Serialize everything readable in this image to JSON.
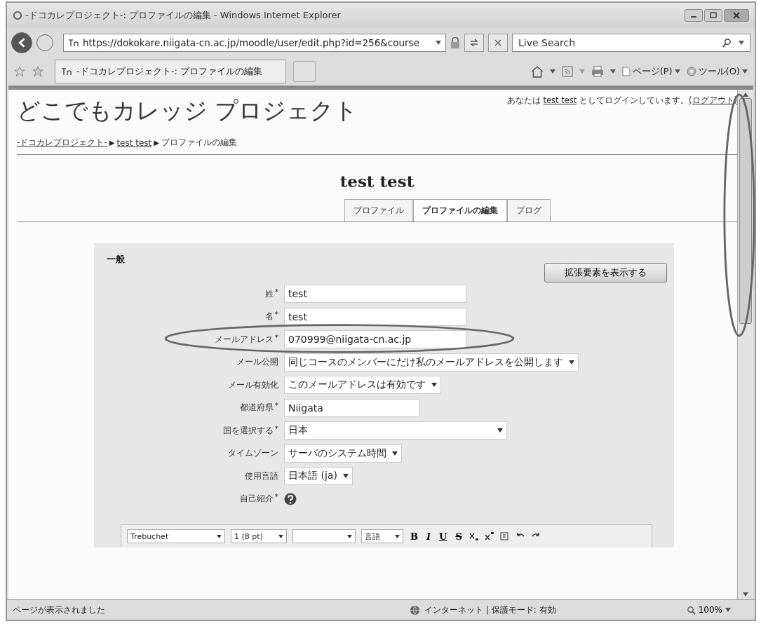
{
  "window": {
    "title": "-ドコカレプロジェクト-: プロファイルの編集 - Windows Internet Explorer"
  },
  "address_bar": {
    "url": "https://dokokare.niigata-cn.ac.jp/moodle/user/edit.php?id=256&course",
    "search_placeholder": "Live Search"
  },
  "browser_tab": {
    "label": "-ドコカレプロジェクト-: プロファイルの編集"
  },
  "command_bar": {
    "page_menu": "ページ(P)",
    "tools_menu": "ツール(O)"
  },
  "page": {
    "site_title": "どこでもカレッジ プロジェクト",
    "login_info": {
      "prefix": "あなたは",
      "user": "test test",
      "suffix": "としてログインしています。",
      "logout": "(ログアウト)"
    },
    "breadcrumb": [
      {
        "label": "-ドコカレプロジェクト-",
        "link": true
      },
      {
        "label": "test test",
        "link": true
      },
      {
        "label": "プロファイルの編集",
        "link": false
      }
    ],
    "separator": "▶",
    "user_heading": "test test",
    "tabs": [
      {
        "label": "プロファイル",
        "selected": false
      },
      {
        "label": "プロファイルの編集",
        "selected": true
      },
      {
        "label": "ブログ",
        "selected": false
      }
    ],
    "form": {
      "section": "一般",
      "advanced_button": "拡張要素を表示する",
      "required_mark": "*",
      "fields": [
        {
          "label": "姓",
          "required": true,
          "kind": "text",
          "value": "test"
        },
        {
          "label": "名",
          "required": true,
          "kind": "text",
          "value": "test"
        },
        {
          "label": "メールアドレス",
          "required": true,
          "kind": "text",
          "value": "070999@niigata-cn.ac.jp"
        },
        {
          "label": "メール公開",
          "required": false,
          "kind": "select",
          "value": "同じコースのメンバーにだけ私のメールアドレスを公開します"
        },
        {
          "label": "メール有効化",
          "required": false,
          "kind": "select",
          "value": "このメールアドレスは有効です"
        },
        {
          "label": "都道府県",
          "required": true,
          "kind": "text",
          "value": "Niigata"
        },
        {
          "label": "国を選択する",
          "required": true,
          "kind": "select",
          "value": "日本"
        },
        {
          "label": "タイムゾーン",
          "required": false,
          "kind": "select",
          "value": "サーバのシステム時間"
        },
        {
          "label": "使用言語",
          "required": false,
          "kind": "select",
          "value": "日本語 (ja)"
        },
        {
          "label": "自己紹介",
          "required": true,
          "kind": "help"
        }
      ],
      "editor_toolbar": {
        "font": "Trebuchet",
        "size": "1 (8 pt)",
        "language": "言語",
        "bold": "B",
        "italic": "I",
        "underline": "U",
        "strike": "S"
      }
    }
  },
  "status_bar": {
    "text": "ページが表示されました",
    "zone": "インターネット | 保護モード: 有効",
    "zoom": "100%"
  }
}
